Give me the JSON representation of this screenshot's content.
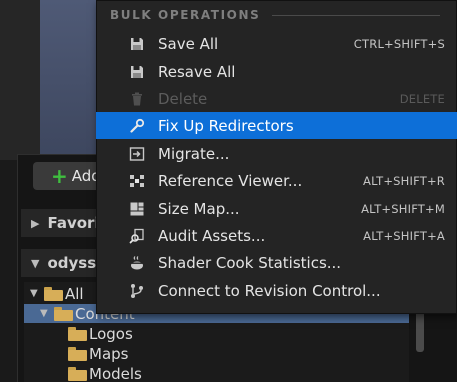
{
  "background": {
    "add_button_label": "Add",
    "favorites_label": "Favori",
    "project_label": "odyss",
    "tree": [
      {
        "label": "All",
        "depth": 0,
        "expanded": true
      },
      {
        "label": "Content",
        "depth": 1,
        "expanded": true,
        "selected": true
      },
      {
        "label": "Logos",
        "depth": 2
      },
      {
        "label": "Maps",
        "depth": 2
      },
      {
        "label": "Models",
        "depth": 2
      }
    ]
  },
  "menu": {
    "section_title": "BULK OPERATIONS",
    "items": [
      {
        "label": "Save All",
        "shortcut": "CTRL+SHIFT+S",
        "icon": "save-icon",
        "disabled": false,
        "highlighted": false
      },
      {
        "label": "Resave All",
        "shortcut": "",
        "icon": "save-icon",
        "disabled": false,
        "highlighted": false
      },
      {
        "label": "Delete",
        "shortcut": "DELETE",
        "icon": "trash-icon",
        "disabled": true,
        "highlighted": false
      },
      {
        "label": "Fix Up Redirectors",
        "shortcut": "",
        "icon": "wrench-icon",
        "disabled": false,
        "highlighted": true
      },
      {
        "label": "Migrate...",
        "shortcut": "",
        "icon": "migrate-icon",
        "disabled": false,
        "highlighted": false
      },
      {
        "label": "Reference Viewer...",
        "shortcut": "ALT+SHIFT+R",
        "icon": "reference-viewer-icon",
        "disabled": false,
        "highlighted": false
      },
      {
        "label": "Size Map...",
        "shortcut": "ALT+SHIFT+M",
        "icon": "size-map-icon",
        "disabled": false,
        "highlighted": false
      },
      {
        "label": "Audit Assets...",
        "shortcut": "ALT+SHIFT+A",
        "icon": "audit-icon",
        "disabled": false,
        "highlighted": false
      },
      {
        "label": "Shader Cook Statistics...",
        "shortcut": "",
        "icon": "teapot-icon",
        "disabled": false,
        "highlighted": false
      },
      {
        "label": "Connect to Revision Control...",
        "shortcut": "",
        "icon": "revision-control-icon",
        "disabled": false,
        "highlighted": false
      }
    ]
  },
  "colors": {
    "highlight": "#0d6fd8",
    "menu_bg": "#242424",
    "folder": "#d7ae58",
    "tree_selected": "#4a6994"
  }
}
